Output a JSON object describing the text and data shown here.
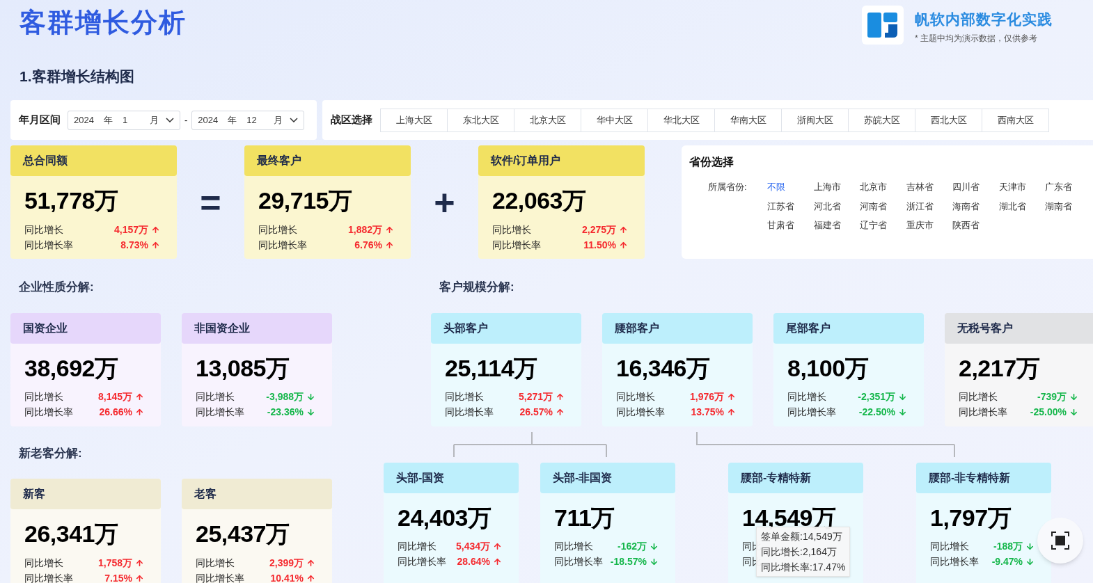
{
  "header": {
    "title": "客群增长分析",
    "brand": "帆软内部数字化实践",
    "note": "* 主题中均为演示数据，仅供参考"
  },
  "section_title": "1.客群增长结构图",
  "date_filter": {
    "label": "年月区间",
    "start": {
      "year": "2024",
      "year_unit": "年",
      "month": "1",
      "month_unit": "月"
    },
    "separator": "-",
    "end": {
      "year": "2024",
      "year_unit": "年",
      "month": "12",
      "month_unit": "月"
    }
  },
  "region_filter": {
    "label": "战区选择",
    "options": [
      {
        "label": "上海大区",
        "selected": false
      },
      {
        "label": "东北大区",
        "selected": false
      },
      {
        "label": "北京大区",
        "selected": false
      },
      {
        "label": "华中大区",
        "selected": false
      },
      {
        "label": "华北大区",
        "selected": false
      },
      {
        "label": "华南大区",
        "selected": false
      },
      {
        "label": "浙闽大区",
        "selected": false
      },
      {
        "label": "苏皖大区",
        "selected": false
      },
      {
        "label": "西北大区",
        "selected": false
      },
      {
        "label": "西南大区",
        "selected": false
      }
    ]
  },
  "totals": {
    "operators": [
      "=",
      "+"
    ],
    "cards": [
      {
        "color": "#f2e162",
        "title": "总合同额",
        "value": "51,778万",
        "stats": [
          {
            "label": "同比增长",
            "value": "4,157万",
            "up": true
          },
          {
            "label": "同比增长率",
            "value": "8.73%",
            "up": true
          }
        ]
      },
      {
        "color": "#f2e162",
        "title": "最终客户",
        "value": "29,715万",
        "stats": [
          {
            "label": "同比增长",
            "value": "1,882万",
            "up": true
          },
          {
            "label": "同比增长率",
            "value": "6.76%",
            "up": true
          }
        ]
      },
      {
        "color": "#f2e162",
        "title": "软件/订单用户",
        "value": "22,063万",
        "stats": [
          {
            "label": "同比增长",
            "value": "2,275万",
            "up": true
          },
          {
            "label": "同比增长率",
            "value": "11.50%",
            "up": true
          }
        ]
      }
    ]
  },
  "province_filter": {
    "title": "省份选择",
    "label": "所属省份:",
    "options": [
      {
        "label": "不限",
        "selected": true
      },
      {
        "label": "上海市",
        "selected": false
      },
      {
        "label": "北京市",
        "selected": false
      },
      {
        "label": "吉林省",
        "selected": false
      },
      {
        "label": "四川省",
        "selected": false
      },
      {
        "label": "天津市",
        "selected": false
      },
      {
        "label": "广东省",
        "selected": false
      },
      {
        "label": "江苏省",
        "selected": false
      },
      {
        "label": "河北省",
        "selected": false
      },
      {
        "label": "河南省",
        "selected": false
      },
      {
        "label": "浙江省",
        "selected": false
      },
      {
        "label": "海南省",
        "selected": false
      },
      {
        "label": "湖北省",
        "selected": false
      },
      {
        "label": "湖南省",
        "selected": false
      },
      {
        "label": "甘肃省",
        "selected": false
      },
      {
        "label": "福建省",
        "selected": false
      },
      {
        "label": "辽宁省",
        "selected": false
      },
      {
        "label": "重庆市",
        "selected": false
      },
      {
        "label": "陕西省",
        "selected": false
      }
    ]
  },
  "ownership": {
    "title": "企业性质分解:",
    "cards": [
      {
        "color": "#e6d7fb",
        "title": "国资企业",
        "value": "38,692万",
        "stats": [
          {
            "label": "同比增长",
            "value": "8,145万",
            "up": true
          },
          {
            "label": "同比增长率",
            "value": "26.66%",
            "up": true
          }
        ]
      },
      {
        "color": "#e6d7fb",
        "title": "非国资企业",
        "value": "13,085万",
        "stats": [
          {
            "label": "同比增长",
            "value": "-3,988万",
            "up": false
          },
          {
            "label": "同比增长率",
            "value": "-23.36%",
            "up": false
          }
        ]
      }
    ]
  },
  "new_old": {
    "title": "新老客分解:",
    "cards": [
      {
        "color": "#f0ebd3",
        "title": "新客",
        "value": "26,341万",
        "stats": [
          {
            "label": "同比增长",
            "value": "1,758万",
            "up": true
          },
          {
            "label": "同比增长率",
            "value": "7.15%",
            "up": true
          }
        ]
      },
      {
        "color": "#f0ebd3",
        "title": "老客",
        "value": "25,437万",
        "stats": [
          {
            "label": "同比增长",
            "value": "2,399万",
            "up": true
          },
          {
            "label": "同比增长率",
            "value": "10.41%",
            "up": true
          }
        ]
      }
    ]
  },
  "scale": {
    "title": "客户规模分解:",
    "cards": [
      {
        "color": "#bdeffc",
        "title": "头部客户",
        "value": "25,114万",
        "stats": [
          {
            "label": "同比增长",
            "value": "5,271万",
            "up": true
          },
          {
            "label": "同比增长率",
            "value": "26.57%",
            "up": true
          }
        ]
      },
      {
        "color": "#bdeffc",
        "title": "腰部客户",
        "value": "16,346万",
        "stats": [
          {
            "label": "同比增长",
            "value": "1,976万",
            "up": true
          },
          {
            "label": "同比增长率",
            "value": "13.75%",
            "up": true
          }
        ]
      },
      {
        "color": "#bdeffc",
        "title": "尾部客户",
        "value": "8,100万",
        "stats": [
          {
            "label": "同比增长",
            "value": "-2,351万",
            "up": false
          },
          {
            "label": "同比增长率",
            "value": "-22.50%",
            "up": false
          }
        ]
      },
      {
        "color": "#e1e2e4",
        "title": "无税号客户",
        "value": "2,217万",
        "stats": [
          {
            "label": "同比增长",
            "value": "-739万",
            "up": false
          },
          {
            "label": "同比增长率",
            "value": "-25.00%",
            "up": false
          }
        ]
      }
    ],
    "sub_cards": [
      {
        "color": "#bdeffc",
        "title": "头部-国资",
        "value": "24,403万",
        "stats": [
          {
            "label": "同比增长",
            "value": "5,434万",
            "up": true
          },
          {
            "label": "同比增长率",
            "value": "28.64%",
            "up": true
          }
        ]
      },
      {
        "color": "#bdeffc",
        "title": "头部-非国资",
        "value": "711万",
        "stats": [
          {
            "label": "同比增长",
            "value": "-162万",
            "up": false
          },
          {
            "label": "同比增长率",
            "value": "-18.57%",
            "up": false
          }
        ]
      },
      {
        "color": "#bdeffc",
        "title": "腰部-专精特新",
        "value": "14,549万",
        "stats": [
          {
            "label": "同比"
          },
          {
            "label": "同比"
          }
        ],
        "tooltip": [
          "签单金额:14,549万",
          "同比增长:2,164万",
          "同比增长率:17.47%"
        ]
      },
      {
        "color": "#bdeffc",
        "title": "腰部-非专精特新",
        "value": "1,797万",
        "stats": [
          {
            "label": "同比增长",
            "value": "-188万",
            "up": false
          },
          {
            "label": "同比增长率",
            "value": "-9.47%",
            "up": false
          }
        ]
      }
    ]
  }
}
